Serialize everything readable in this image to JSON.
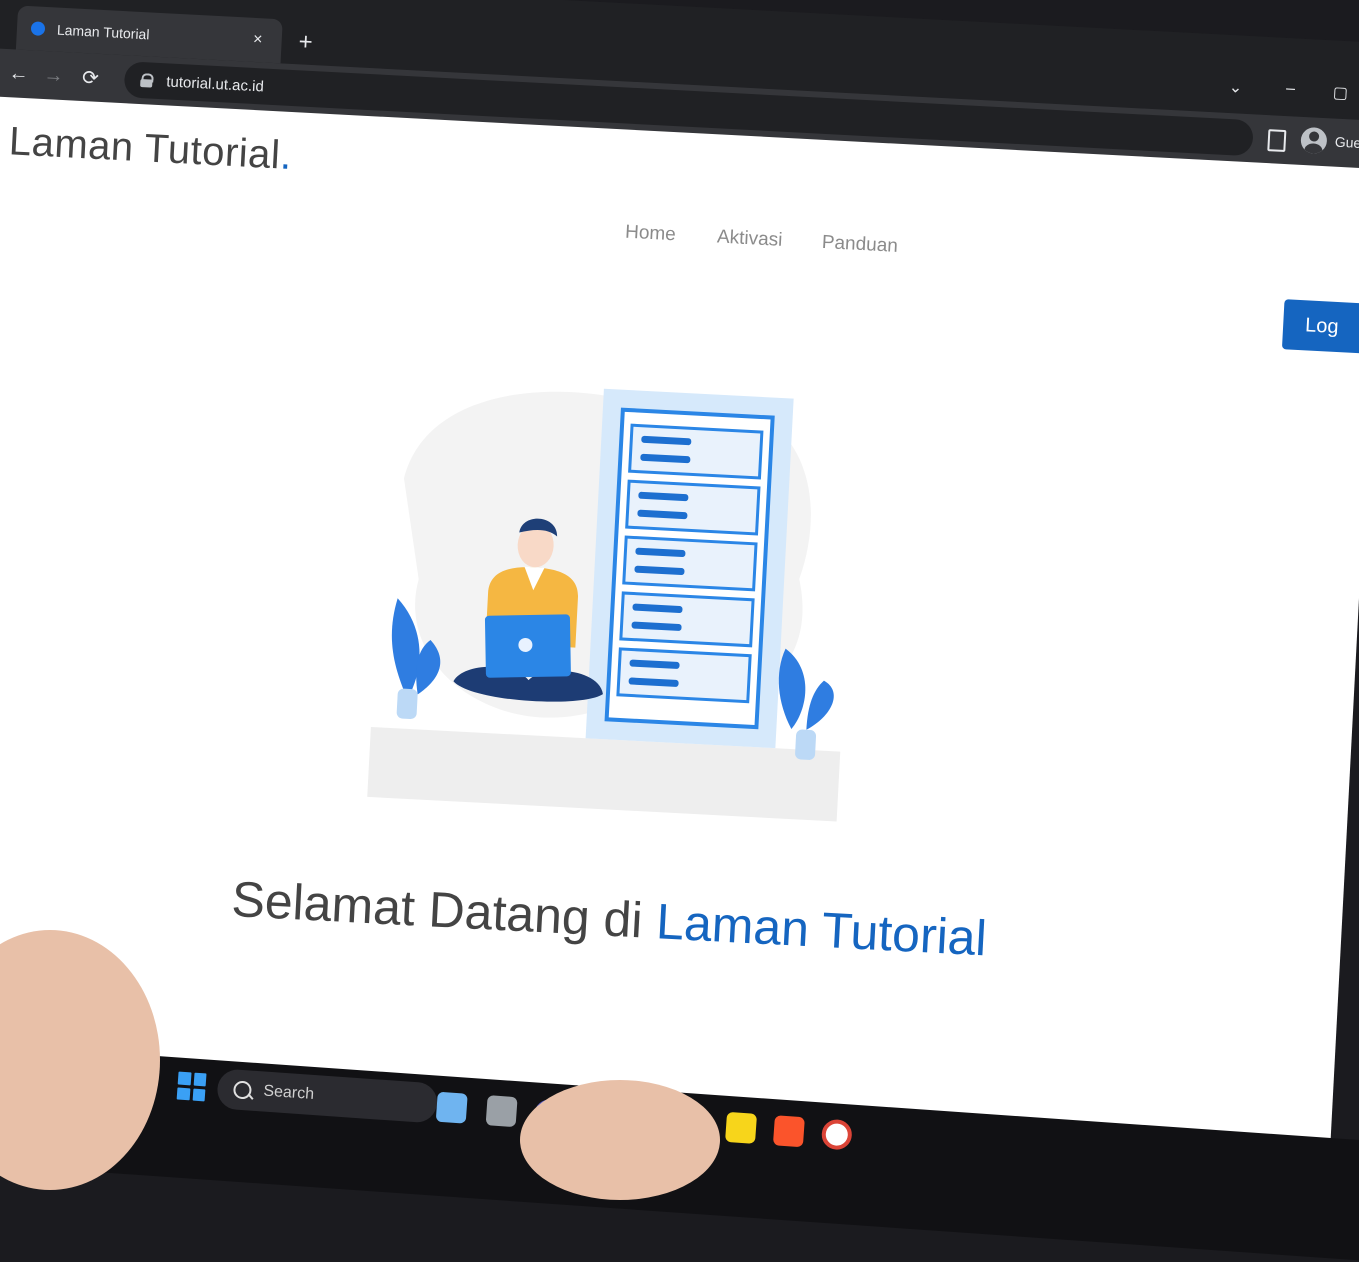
{
  "browser": {
    "tab": {
      "title": "Laman Tutorial",
      "close_glyph": "×"
    },
    "new_tab_glyph": "+",
    "window_controls": [
      "⌄",
      "–",
      "▢"
    ],
    "nav": {
      "back_glyph": "←",
      "forward_glyph": "→",
      "reload_glyph": "⟳"
    },
    "address": "tutorial.ut.ac.id",
    "profile_label": "Guest",
    "icons": [
      "lock-icon",
      "side-panel-icon",
      "profile-avatar-icon"
    ]
  },
  "page": {
    "brand": "Laman Tutorial",
    "brand_dot": ".",
    "nav_links": [
      "Home",
      "Aktivasi",
      "Panduan"
    ],
    "login_label": "Log",
    "headline_start": "Selamat Datang di ",
    "headline_accent": "Laman Tutorial",
    "colors": {
      "accent": "#1565c0",
      "text": "#444444",
      "nav_text": "#8b8b8b"
    }
  },
  "taskbar": {
    "search_label": "Search",
    "apps": [
      "widgets-icon",
      "task-view-icon",
      "chat-icon",
      "store-icon",
      "file-explorer-icon",
      "edge-icon",
      "sticky-notes-icon",
      "brave-icon",
      "chrome-icon"
    ]
  }
}
